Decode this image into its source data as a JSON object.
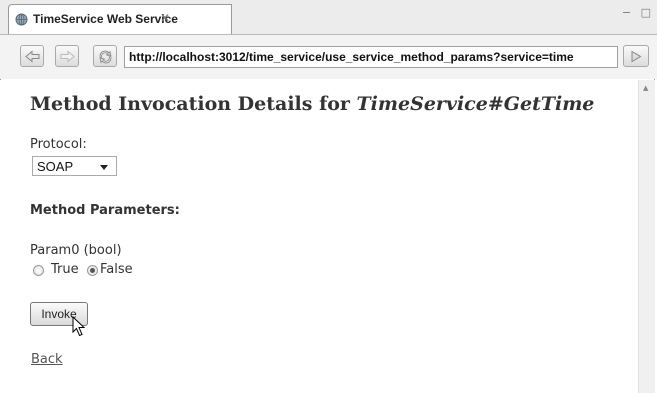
{
  "tab": {
    "title": "TimeService Web Service",
    "close_glyph": "✕",
    "icon": "globe-icon"
  },
  "window_controls": {
    "minimize": "−",
    "maximize": "□"
  },
  "toolbar": {
    "back_icon": "back-arrow-icon",
    "forward_icon": "forward-arrow-icon",
    "refresh_icon": "refresh-icon",
    "url": "http://localhost:3012/time_service/use_service_method_params?service=time",
    "go_icon": "go-arrow-icon"
  },
  "page": {
    "title_prefix": "Method Invocation Details for ",
    "title_method": "TimeService#GetTime",
    "protocol_label": "Protocol:",
    "protocol_value": "SOAP",
    "params_heading": "Method Parameters:",
    "param0_label": "Param0 (bool)",
    "option_true": "True",
    "option_false": "False",
    "selected_option": "False",
    "invoke_button": "Invoke",
    "back_link": "Back"
  }
}
